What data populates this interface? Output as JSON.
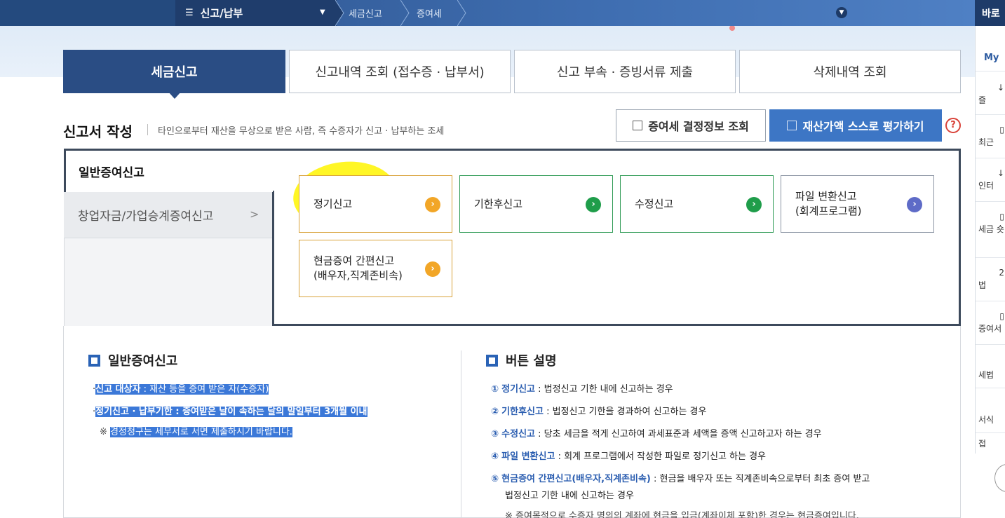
{
  "nav": {
    "menu_label": "신고/납부",
    "breadcrumb": [
      "세금신고",
      "증여세"
    ],
    "right_label": "바로"
  },
  "quick": {
    "my": "My",
    "items": [
      "즐",
      "최근",
      "인터",
      "세금 숏",
      "법",
      "증여서",
      "세법",
      "서식",
      "접"
    ]
  },
  "tabs": [
    "세금신고",
    "신고내역 조회 (접수증 · 납부서)",
    "신고 부속 · 증빙서류 제출",
    "삭제내역 조회"
  ],
  "section": {
    "title": "신고서 작성",
    "desc": "타인으로부터 재산을 무상으로 받은 사람, 즉 수증자가 신고 · 납부하는 조세",
    "btn_lookup": "증여세 결정정보 조회",
    "btn_assess": "재산가액 스스로 평가하기",
    "help": "?"
  },
  "side_tabs": [
    "일반증여신고",
    "창업자금/가업승계증여신고"
  ],
  "cards": [
    {
      "line1": "정기신고",
      "line2": "",
      "arrow": "›"
    },
    {
      "line1": "기한후신고",
      "line2": "",
      "arrow": "›"
    },
    {
      "line1": "수정신고",
      "line2": "",
      "arrow": "›"
    },
    {
      "line1": "파일 변환신고",
      "line2": "(회계프로그램)",
      "arrow": "›"
    },
    {
      "line1": "현금증여 간편신고",
      "line2": "(배우자,직계존비속)",
      "arrow": "›"
    }
  ],
  "colors": {
    "accent": "#2a4d84",
    "button": "#3d76c5",
    "orange": "#f2a627",
    "green": "#1f9d4a",
    "purple": "#5e6bc7",
    "highlight": "#fff500"
  },
  "info_left": {
    "title": "일반증여신고",
    "l1_key": "신고 대상자",
    "l1_val": " : 재산 등을 증여 받은 자(수증자)",
    "l2_key": "정기신고 · 납부기한",
    "l2_val": " : 증여받은 날이 속하는 달의 말일부터 3개월 이내",
    "note_mark": "※",
    "note": "경정청구는 세무서로 서면 제출하시기 바랍니다."
  },
  "info_right": {
    "title": "버튼 설명",
    "items": [
      {
        "num": "①",
        "key": "정기신고",
        "desc": " : 법정신고 기한 내에 신고하는 경우"
      },
      {
        "num": "②",
        "key": "기한후신고",
        "desc": " : 법정신고 기한을 경과하여 신고하는 경우"
      },
      {
        "num": "③",
        "key": "수정신고",
        "desc": " : 당초 세금을 적게 신고하여 과세표준과 세액을 증액 신고하고자 하는 경우"
      },
      {
        "num": "④",
        "key": "파일 변환신고",
        "desc": " : 회계 프로그램에서 작성한 파일로 정기신고 하는 경우"
      },
      {
        "num": "⑤",
        "key": "현금증여 간편신고(배우자,직계존비속)",
        "desc": " : 현금을 배우자 또는 직계존비속으로부터 최초 증여 받고"
      }
    ],
    "item5_cont": "법정신고 기한 내에 신고하는 경우",
    "note": "※ 증여목적으로 수증자 명의의 계좌에 현금을 입금(계좌이체 포함)한 경우는 현금증여입니다."
  }
}
